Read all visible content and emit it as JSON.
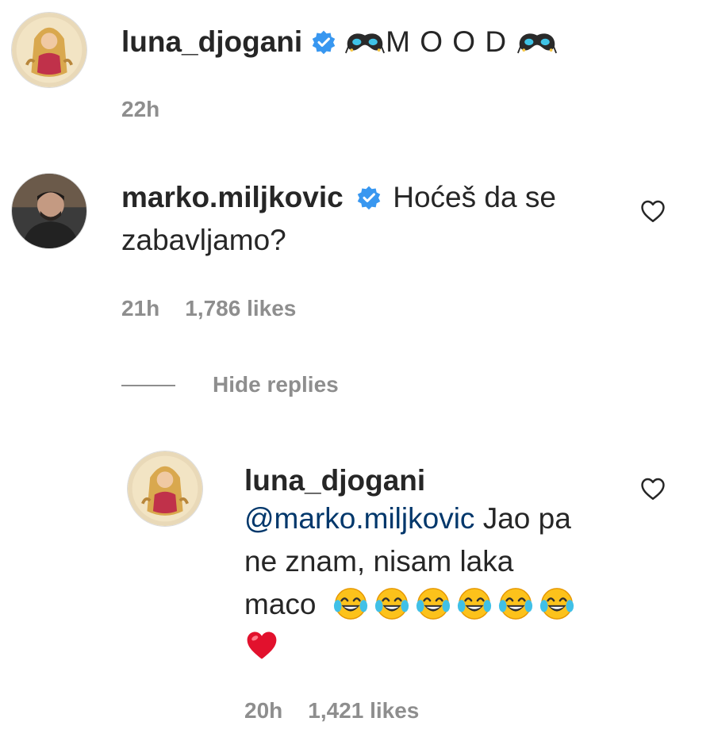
{
  "caption": {
    "username": "luna_djogani",
    "verified": true,
    "text": "M O O D",
    "time": "22h"
  },
  "comment": {
    "username": "marko.miljkovic",
    "verified": true,
    "text_line1": "Hoćeš da se",
    "text_line2": "zabavljamo?",
    "time": "21h",
    "likes": "1,786 likes"
  },
  "hide_replies": "Hide replies",
  "reply": {
    "username": "luna_djogani",
    "mention": "@marko.miljkovic",
    "text_line1": " Jao pa",
    "text_line2": "ne znam, nisam laka",
    "text_line3": "maco",
    "emojis": [
      "face-with-tears-of-joy",
      "face-with-tears-of-joy",
      "face-with-tears-of-joy",
      "face-with-tears-of-joy",
      "face-with-tears-of-joy",
      "face-with-tears-of-joy",
      "red-heart"
    ],
    "time": "20h",
    "likes": "1,421 likes"
  },
  "colors": {
    "text": "#262626",
    "secondary": "#8e8e8e",
    "verified_blue": "#3897f0",
    "mention": "#00376b",
    "heart_red": "#ed4956"
  }
}
